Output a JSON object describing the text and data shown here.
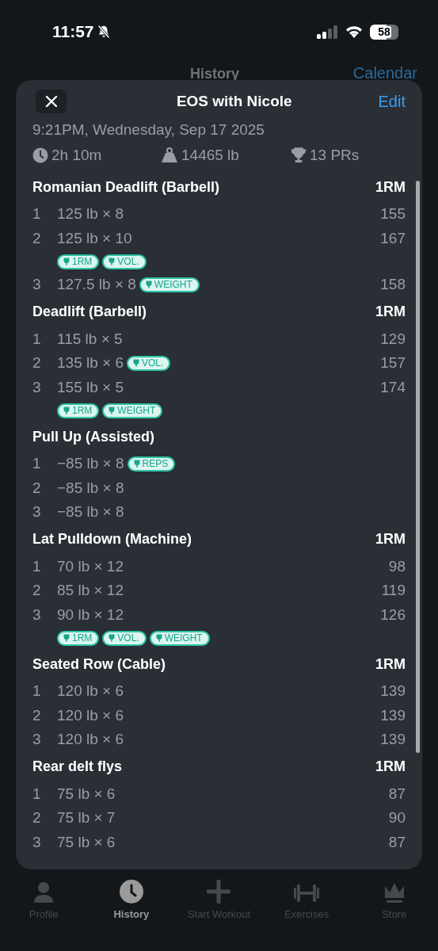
{
  "status_bar": {
    "time": "11:57",
    "silent": true,
    "battery": "58"
  },
  "background_header": {
    "title": "History",
    "action": "Calendar"
  },
  "sheet": {
    "title": "EOS with Nicole",
    "action": "Edit",
    "date": "9:21PM, Wednesday, Sep 17 2025",
    "stats": [
      {
        "kind": "duration",
        "text": "2h 10m"
      },
      {
        "kind": "volume",
        "text": "14465 lb"
      },
      {
        "kind": "prs",
        "text": "13 PRs"
      }
    ]
  },
  "exercises": [
    {
      "name": "Romanian Deadlift (Barbell)",
      "column": "1RM",
      "sets": [
        {
          "number": "1",
          "text": "125 lb × 8",
          "value": "155"
        },
        {
          "number": "2",
          "text": "125 lb × 10",
          "value": "167",
          "badges_below": [
            "1RM",
            "VOL."
          ]
        },
        {
          "number": "3",
          "text": "127.5 lb × 8",
          "value": "158",
          "inline_badges": [
            "WEIGHT"
          ]
        }
      ]
    },
    {
      "name": "Deadlift (Barbell)",
      "column": "1RM",
      "sets": [
        {
          "number": "1",
          "text": "115 lb × 5",
          "value": "129"
        },
        {
          "number": "2",
          "text": "135 lb × 6",
          "value": "157",
          "inline_badges": [
            "VOL."
          ]
        },
        {
          "number": "3",
          "text": "155 lb × 5",
          "value": "174",
          "badges_below": [
            "1RM",
            "WEIGHT"
          ]
        }
      ]
    },
    {
      "name": "Pull Up (Assisted)",
      "sets": [
        {
          "number": "1",
          "text": "−85 lb × 8",
          "inline_badges": [
            "REPS"
          ]
        },
        {
          "number": "2",
          "text": "−85 lb × 8"
        },
        {
          "number": "3",
          "text": "−85 lb × 8"
        }
      ]
    },
    {
      "name": "Lat Pulldown (Machine)",
      "column": "1RM",
      "sets": [
        {
          "number": "1",
          "text": "70 lb × 12",
          "value": "98"
        },
        {
          "number": "2",
          "text": "85 lb × 12",
          "value": "119"
        },
        {
          "number": "3",
          "text": "90 lb × 12",
          "value": "126",
          "badges_below": [
            "1RM",
            "VOL.",
            "WEIGHT"
          ]
        }
      ]
    },
    {
      "name": "Seated Row (Cable)",
      "column": "1RM",
      "sets": [
        {
          "number": "1",
          "text": "120 lb × 6",
          "value": "139"
        },
        {
          "number": "2",
          "text": "120 lb × 6",
          "value": "139"
        },
        {
          "number": "3",
          "text": "120 lb × 6",
          "value": "139"
        }
      ]
    },
    {
      "name": "Rear delt flys",
      "column": "1RM",
      "sets": [
        {
          "number": "1",
          "text": "75 lb × 6",
          "value": "87"
        },
        {
          "number": "2",
          "text": "75 lb × 7",
          "value": "90"
        },
        {
          "number": "3",
          "text": "75 lb × 6",
          "value": "87"
        }
      ]
    }
  ],
  "tab_bar": [
    {
      "kind": "profile",
      "label": "Profile",
      "selected": false
    },
    {
      "kind": "history",
      "label": "History",
      "selected": true
    },
    {
      "kind": "start",
      "label": "Start Workout",
      "selected": false
    },
    {
      "kind": "exercises",
      "label": "Exercises",
      "selected": false
    },
    {
      "kind": "store",
      "label": "Store",
      "selected": false
    }
  ]
}
